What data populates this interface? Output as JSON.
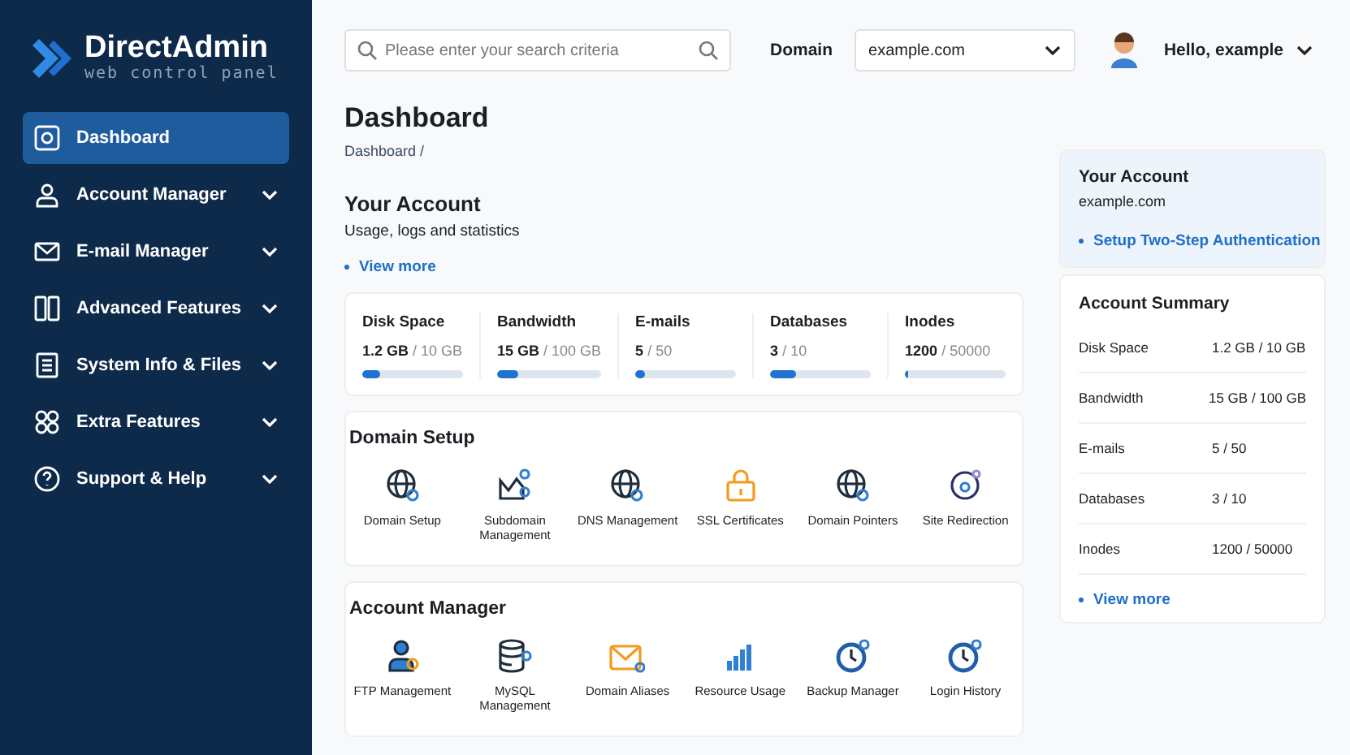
{
  "logo": {
    "title": "DirectAdmin",
    "subtitle": "web control panel"
  },
  "sidebar": {
    "items": [
      {
        "label": "Dashboard",
        "selected": true,
        "expandable": false
      },
      {
        "label": "Account Manager",
        "selected": false,
        "expandable": true
      },
      {
        "label": "E-mail Manager",
        "selected": false,
        "expandable": true
      },
      {
        "label": "Advanced Features",
        "selected": false,
        "expandable": true
      },
      {
        "label": "System Info & Files",
        "selected": false,
        "expandable": true
      },
      {
        "label": "Extra Features",
        "selected": false,
        "expandable": true
      },
      {
        "label": "Support & Help",
        "selected": false,
        "expandable": true
      }
    ]
  },
  "topbar": {
    "search": {
      "placeholder": "Please enter your search criteria"
    },
    "domain_label": "Domain",
    "domain_value": "example.com",
    "user": "Hello, example"
  },
  "page": {
    "title": "Dashboard",
    "breadcrumb": "Dashboard /"
  },
  "your_account": {
    "title": "Your Account",
    "subtitle": "Usage, logs and statistics",
    "link": "View more"
  },
  "usage": [
    {
      "name": "Disk Space",
      "used": "1.2 GB",
      "limit": "/ 10 GB",
      "level": 0.18
    },
    {
      "name": "Bandwidth",
      "used": "15 GB",
      "limit": "/ 100 GB",
      "level": 0.2
    },
    {
      "name": "E-mails",
      "used": "5",
      "limit": "/ 50",
      "level": 0.1
    },
    {
      "name": "Databases",
      "used": "3",
      "limit": "/ 10",
      "level": 0.25
    },
    {
      "name": "Inodes",
      "used": "1200",
      "limit": "/ 50000",
      "level": 0.04
    }
  ],
  "sections": [
    {
      "title": "Domain Setup",
      "items": [
        "Domain Setup",
        "Subdomain Management",
        "DNS Management",
        "SSL Certificates",
        "Domain Pointers",
        "Site Redirection"
      ]
    },
    {
      "title": "Account Manager",
      "items": [
        "FTP Management",
        "MySQL Management",
        "Domain Aliases",
        "Resource Usage",
        "Backup Manager",
        "Login History"
      ]
    }
  ],
  "account_card": {
    "title": "Your Account",
    "domain": "example.com",
    "link": "Setup Two-Step Authentication"
  },
  "summary": {
    "title": "Account Summary",
    "rows": [
      {
        "label": "Disk Space",
        "value": "1.2 GB / 10 GB"
      },
      {
        "label": "Bandwidth",
        "value": "15 GB / 100 GB"
      },
      {
        "label": "E-mails",
        "value": "5 / 50"
      },
      {
        "label": "Databases",
        "value": "3 / 10"
      },
      {
        "label": "Inodes",
        "value": "1200 / 50000"
      }
    ],
    "link": "View more"
  }
}
